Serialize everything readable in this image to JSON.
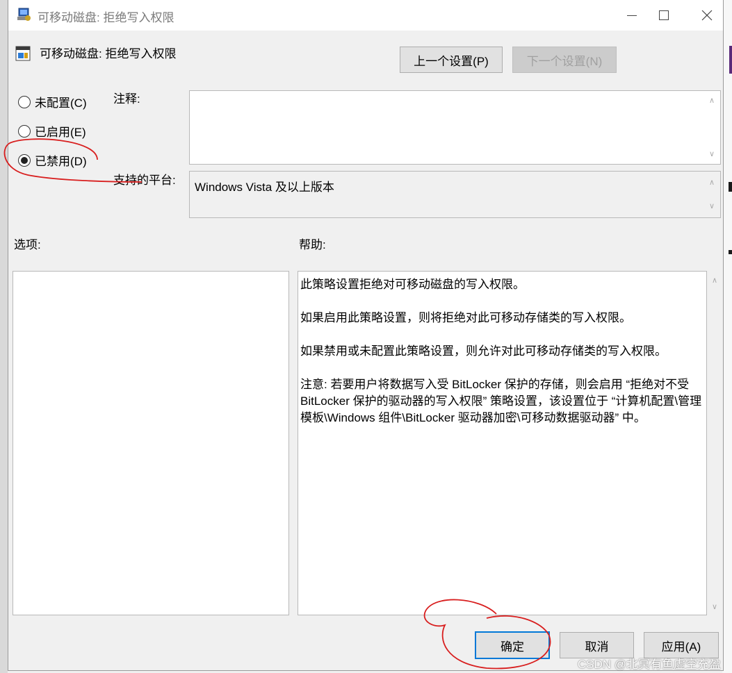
{
  "window": {
    "title": "可移动磁盘: 拒绝写入权限",
    "controls": [
      "minimize",
      "maximize",
      "close"
    ]
  },
  "header": {
    "policy_title": "可移动磁盘: 拒绝写入权限",
    "prev_setting": "上一个设置(P)",
    "next_setting": "下一个设置(N)"
  },
  "state": {
    "options": [
      {
        "label": "未配置(C)",
        "checked": false
      },
      {
        "label": "已启用(E)",
        "checked": false
      },
      {
        "label": "已禁用(D)",
        "checked": true
      }
    ]
  },
  "comment": {
    "label": "注释:",
    "value": ""
  },
  "platform": {
    "label": "支持的平台:",
    "value": "Windows Vista 及以上版本"
  },
  "options_pane": {
    "label": "选项:"
  },
  "help_pane": {
    "label": "帮助:",
    "paragraphs": [
      "此策略设置拒绝对可移动磁盘的写入权限。",
      "如果启用此策略设置，则将拒绝对此可移动存储类的写入权限。",
      "如果禁用或未配置此策略设置，则允许对此可移动存储类的写入权限。",
      "注意: 若要用户将数据写入受 BitLocker 保护的存储，则会启用 “拒绝对不受 BitLocker 保护的驱动器的写入权限” 策略设置，该设置位于 “计算机配置\\管理模板\\Windows 组件\\BitLocker 驱动器加密\\可移动数据驱动器” 中。"
    ]
  },
  "footer": {
    "ok": "确定",
    "cancel": "取消",
    "apply": "应用(A)"
  },
  "watermark": "CSDN @北冥有鱼虚空充盈",
  "colors": {
    "annotation": "#d81e1e",
    "focus": "#0078d7"
  }
}
